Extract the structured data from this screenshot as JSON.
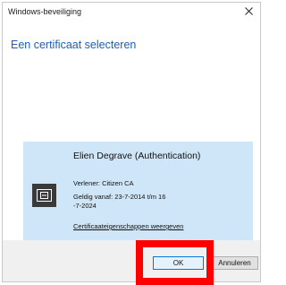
{
  "window": {
    "title": "Windows-beveiliging"
  },
  "dialog": {
    "heading": "Een certificaat selecteren"
  },
  "certificate": {
    "name": "Elien Degrave (Authentication)",
    "issuer": "Verlener: Citizen CA",
    "validity": "Geldig vanaf: 23-7-2014 t/m 16 -7-2024",
    "properties_link": "Certificaateigenschappen weergeven",
    "icon": "certificate-card-icon"
  },
  "buttons": {
    "ok_label": "OK",
    "cancel_label": "Annuleren"
  },
  "icons": {
    "close": "close-icon"
  },
  "colors": {
    "heading": "#1f5fb5",
    "card_background": "#cfe6f8",
    "footer_background": "#f0f0f0",
    "highlight": "#ff0000",
    "default_button_border": "#0078d7"
  }
}
